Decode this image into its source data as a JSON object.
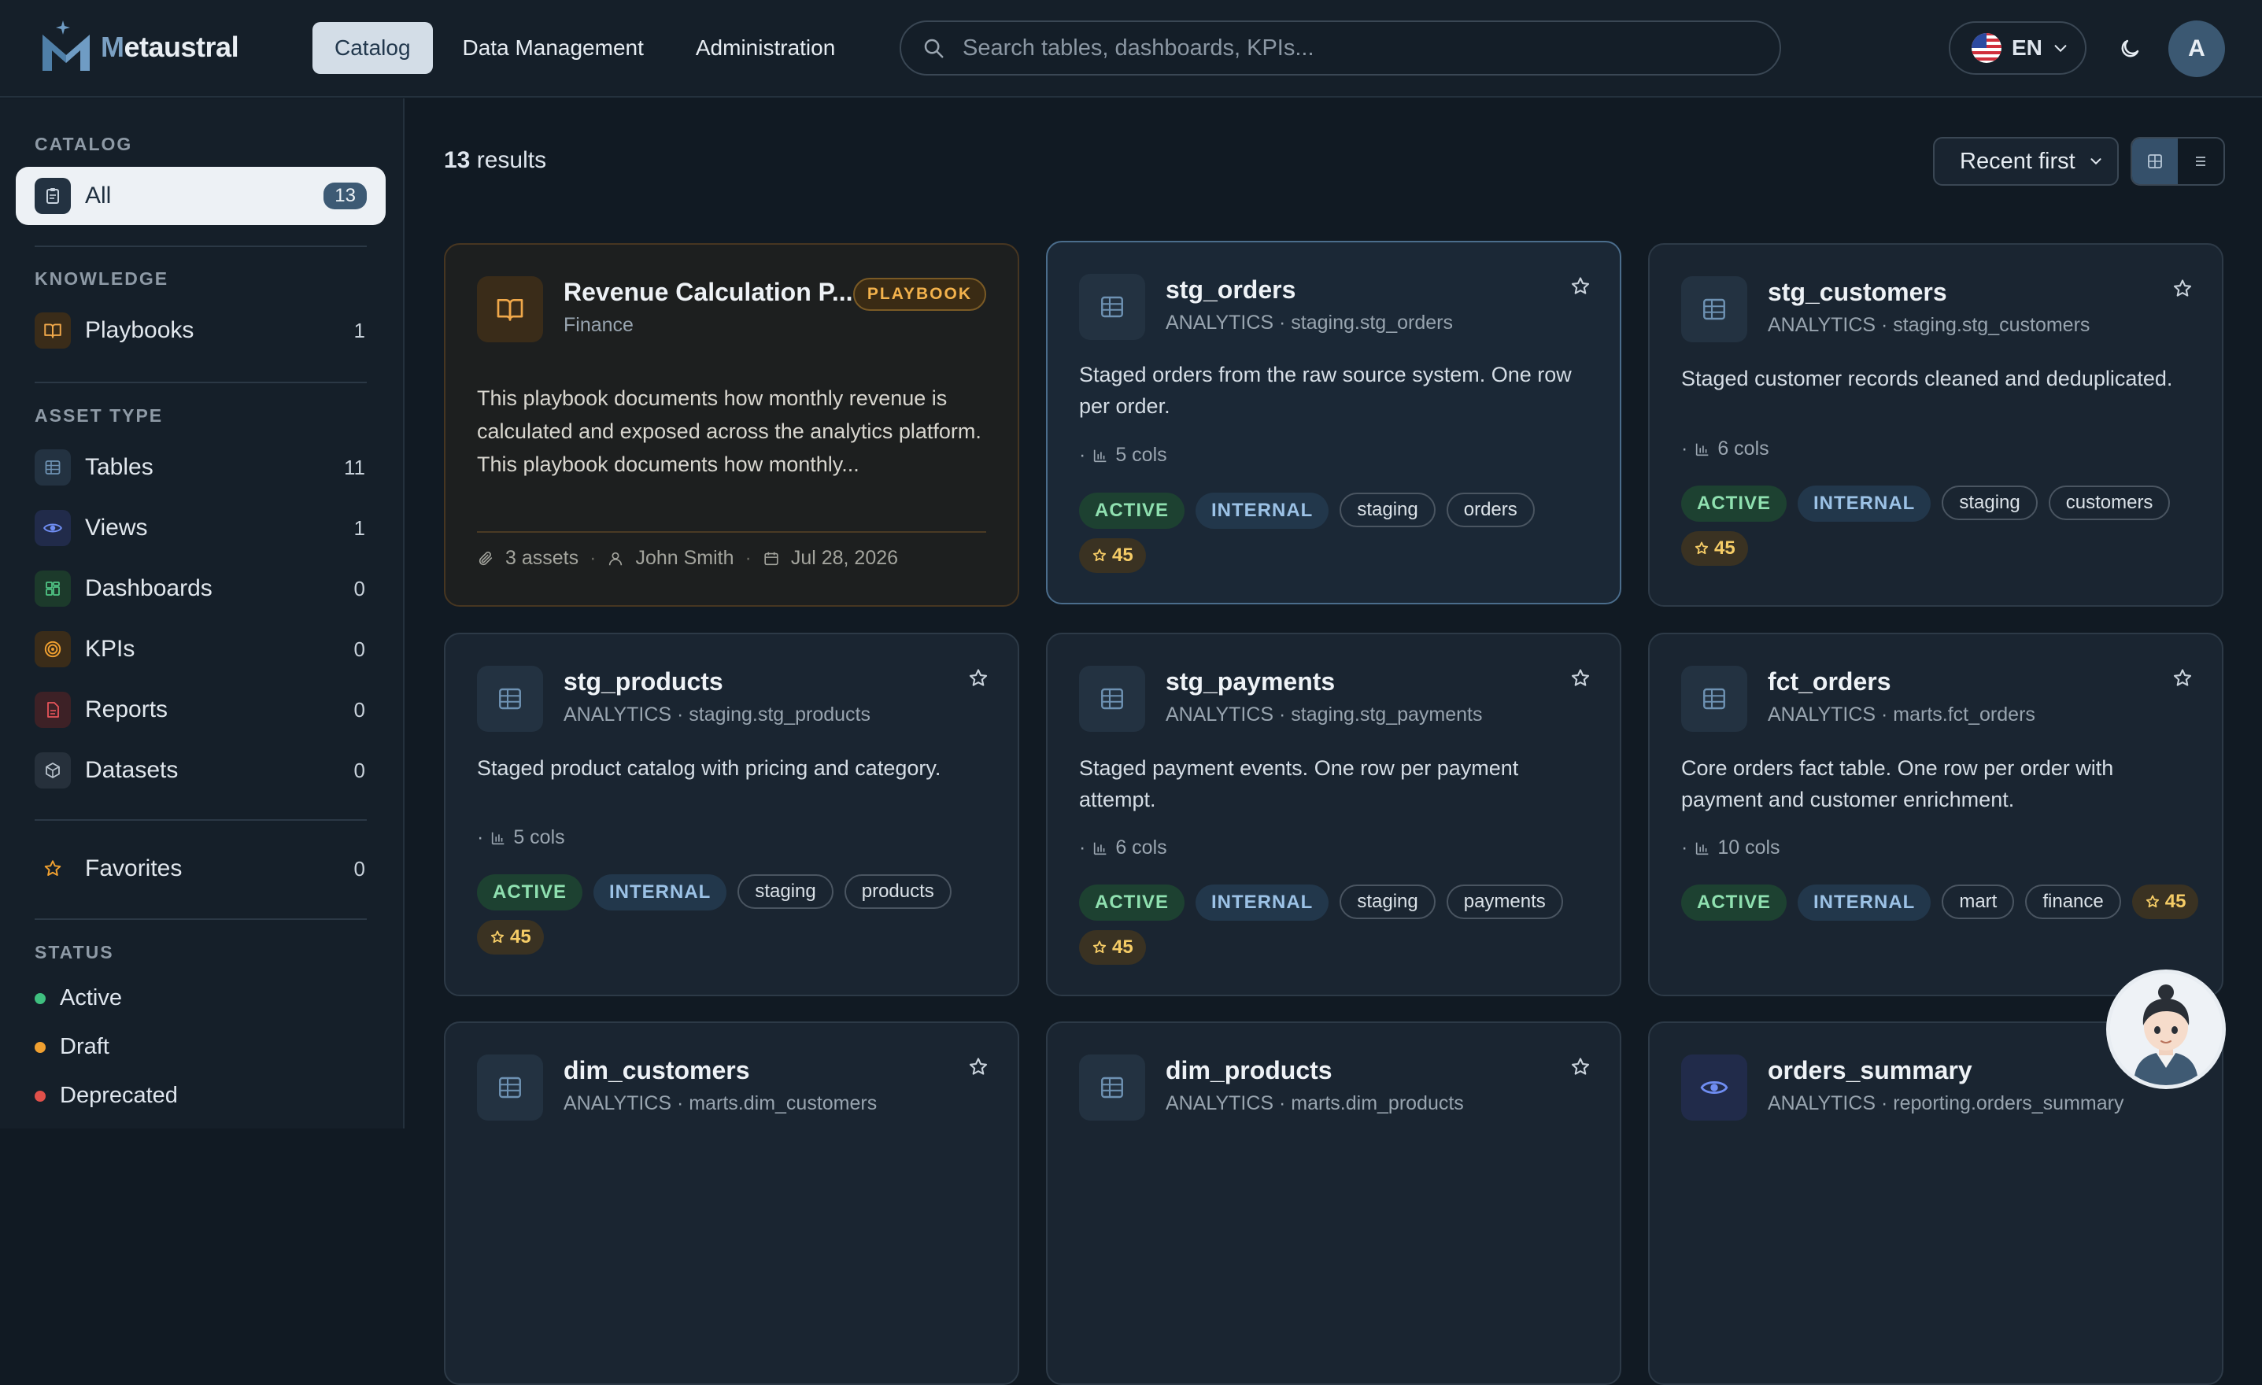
{
  "app": {
    "brand_prefix": "M",
    "brand_rest": "etaustral"
  },
  "nav": [
    {
      "label": "Catalog",
      "active": true
    },
    {
      "label": "Data Management",
      "active": false
    },
    {
      "label": "Administration",
      "active": false
    }
  ],
  "search": {
    "placeholder": "Search tables, dashboards, KPIs..."
  },
  "lang": {
    "code": "EN"
  },
  "user": {
    "initial": "A"
  },
  "sidebar": {
    "catalog_title": "CATALOG",
    "all": {
      "label": "All",
      "count": "13"
    },
    "knowledge_title": "KNOWLEDGE",
    "playbooks": {
      "label": "Playbooks",
      "count": "1"
    },
    "asset_title": "ASSET TYPE",
    "assets": [
      {
        "label": "Tables",
        "count": "11",
        "icon": "table-icon"
      },
      {
        "label": "Views",
        "count": "1",
        "icon": "eye-icon"
      },
      {
        "label": "Dashboards",
        "count": "0",
        "icon": "dashboard-icon"
      },
      {
        "label": "KPIs",
        "count": "0",
        "icon": "target-icon"
      },
      {
        "label": "Reports",
        "count": "0",
        "icon": "report-icon"
      },
      {
        "label": "Datasets",
        "count": "0",
        "icon": "cube-icon"
      }
    ],
    "favorites": {
      "label": "Favorites",
      "count": "0"
    },
    "status_title": "STATUS",
    "statuses": [
      {
        "label": "Active",
        "color": "#3fbf7f"
      },
      {
        "label": "Draft",
        "color": "#f0a030"
      },
      {
        "label": "Deprecated",
        "color": "#e0504a"
      }
    ]
  },
  "results": {
    "count": "13",
    "label": "results"
  },
  "sort": {
    "selected": "Recent first"
  },
  "playbook_card": {
    "title": "Revenue Calculation P...",
    "subtitle": "Finance",
    "badge": "PLAYBOOK",
    "description": "This playbook documents how monthly revenue is calculated and exposed across the analytics platform. This playbook documents how monthly...",
    "assets": "3 assets",
    "author": "John Smith",
    "date": "Jul 28, 2026"
  },
  "cards": [
    {
      "title": "stg_orders",
      "subtitle": "ANALYTICS · staging.stg_orders",
      "description": "Staged orders from the raw source system. One row per order.",
      "cols": "5 cols",
      "status": "ACTIVE",
      "class": "INTERNAL",
      "tags": [
        "staging",
        "orders"
      ],
      "score": "45"
    },
    {
      "title": "stg_customers",
      "subtitle": "ANALYTICS · staging.stg_customers",
      "description": "Staged customer records cleaned and deduplicated.",
      "cols": "6 cols",
      "status": "ACTIVE",
      "class": "INTERNAL",
      "tags": [
        "staging",
        "customers"
      ],
      "score": "45"
    },
    {
      "title": "stg_products",
      "subtitle": "ANALYTICS · staging.stg_products",
      "description": "Staged product catalog with pricing and category.",
      "cols": "5 cols",
      "status": "ACTIVE",
      "class": "INTERNAL",
      "tags": [
        "staging",
        "products"
      ],
      "score": "45"
    },
    {
      "title": "stg_payments",
      "subtitle": "ANALYTICS · staging.stg_payments",
      "description": "Staged payment events. One row per payment attempt.",
      "cols": "6 cols",
      "status": "ACTIVE",
      "class": "INTERNAL",
      "tags": [
        "staging",
        "payments"
      ],
      "score": "45"
    },
    {
      "title": "fct_orders",
      "subtitle": "ANALYTICS · marts.fct_orders",
      "description": "Core orders fact table. One row per order with payment and customer enrichment.",
      "cols": "10 cols",
      "status": "ACTIVE",
      "class": "INTERNAL",
      "tags": [
        "mart",
        "finance"
      ],
      "score": "45"
    },
    {
      "title": "dim_customers",
      "subtitle": "ANALYTICS · marts.dim_customers"
    },
    {
      "title": "dim_products",
      "subtitle": "ANALYTICS · marts.dim_products"
    },
    {
      "title": "orders_summary",
      "subtitle": "ANALYTICS · reporting.orders_summary"
    }
  ]
}
